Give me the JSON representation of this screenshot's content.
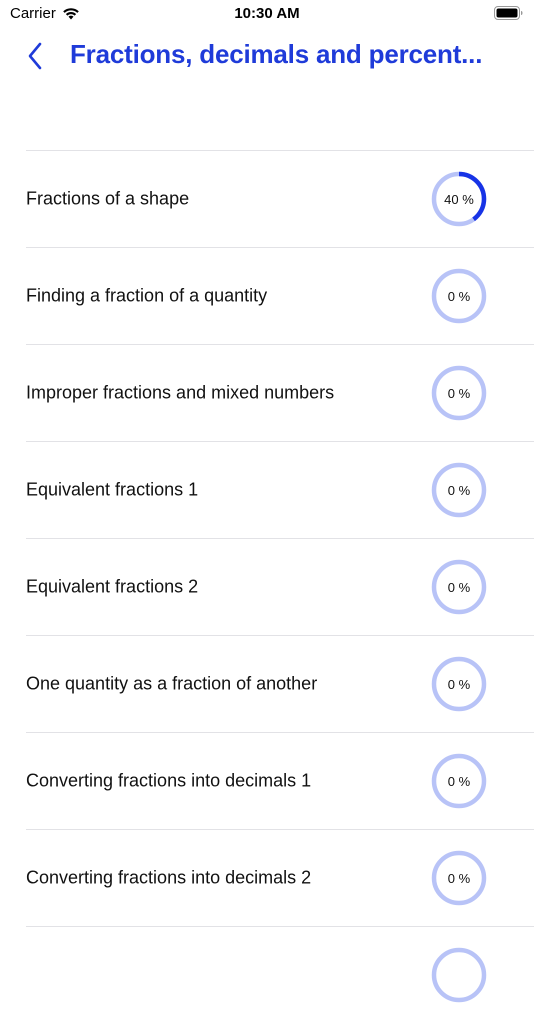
{
  "status_bar": {
    "carrier": "Carrier",
    "time": "10:30 AM"
  },
  "nav": {
    "back_icon": "chevron-left-icon",
    "title": "Fractions, decimals and percent..."
  },
  "colors": {
    "accent": "#1f3bd9",
    "ring_track": "#b8c3f7",
    "ring_progress": "#1733e6"
  },
  "topics": [
    {
      "label": "Fractions of a shape",
      "progress_text": "40 %",
      "progress": 0.4
    },
    {
      "label": "Finding a fraction of a quantity",
      "progress_text": "0 %",
      "progress": 0
    },
    {
      "label": "Improper fractions and mixed numbers",
      "progress_text": "0 %",
      "progress": 0
    },
    {
      "label": "Equivalent fractions 1",
      "progress_text": "0 %",
      "progress": 0
    },
    {
      "label": "Equivalent fractions 2",
      "progress_text": "0 %",
      "progress": 0
    },
    {
      "label": "One quantity as a fraction of another",
      "progress_text": "0 %",
      "progress": 0
    },
    {
      "label": "Converting fractions into decimals 1",
      "progress_text": "0 %",
      "progress": 0
    },
    {
      "label": "Converting fractions into decimals 2",
      "progress_text": "0 %",
      "progress": 0
    },
    {
      "label": "",
      "progress_text": "",
      "progress": 0
    }
  ]
}
